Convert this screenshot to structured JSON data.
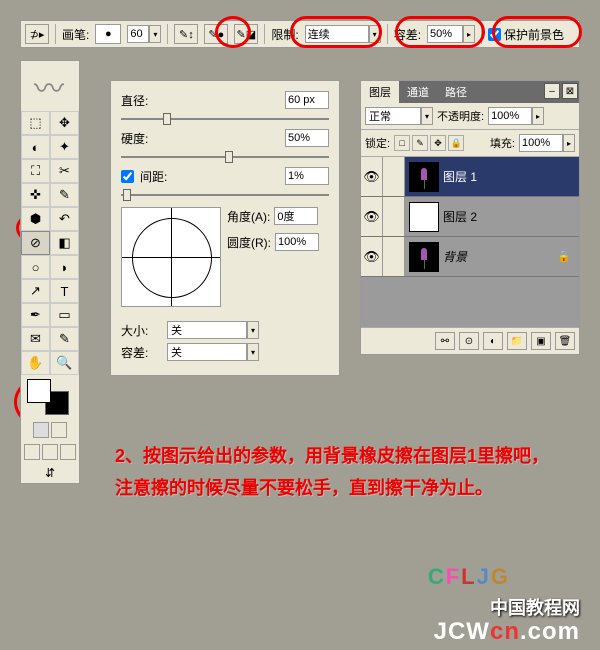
{
  "toolbar": {
    "brush_label": "画笔:",
    "brush_size": "60",
    "limit_label": "限制:",
    "limit_value": "连续",
    "tolerance_label": "容差:",
    "tolerance_value": "50%",
    "protect_fg_label": "保护前景色"
  },
  "brush_panel": {
    "diameter_label": "直径:",
    "diameter_value": "60 px",
    "hardness_label": "硬度:",
    "hardness_value": "50%",
    "spacing_label": "间距:",
    "spacing_value": "1%",
    "angle_label": "角度(A):",
    "angle_value": "0度",
    "roundness_label": "圆度(R):",
    "roundness_value": "100%",
    "size_label": "大小:",
    "size_value": "关",
    "tolerance_label": "容差:",
    "tolerance_value": "关"
  },
  "layers_panel": {
    "tabs": [
      "图层",
      "通道",
      "路径"
    ],
    "blend_mode": "正常",
    "opacity_label": "不透明度:",
    "opacity_value": "100%",
    "lock_label": "锁定:",
    "fill_label": "填充:",
    "fill_value": "100%",
    "layers": [
      {
        "name": "图层 1",
        "selected": true,
        "thumb": "flower"
      },
      {
        "name": "图层 2",
        "selected": false,
        "thumb": "white"
      },
      {
        "name": "背景",
        "selected": false,
        "thumb": "flower",
        "italic": true,
        "locked": true
      }
    ]
  },
  "instruction_text": "2、按图示给出的参数，用背景橡皮擦在图层1里擦吧，注意擦的时候尽量不要松手，直到擦干净为止。",
  "watermark": {
    "site_name": "中国教程网",
    "url_a": "JCW",
    "url_b": "cn",
    "url_c": ".com"
  }
}
